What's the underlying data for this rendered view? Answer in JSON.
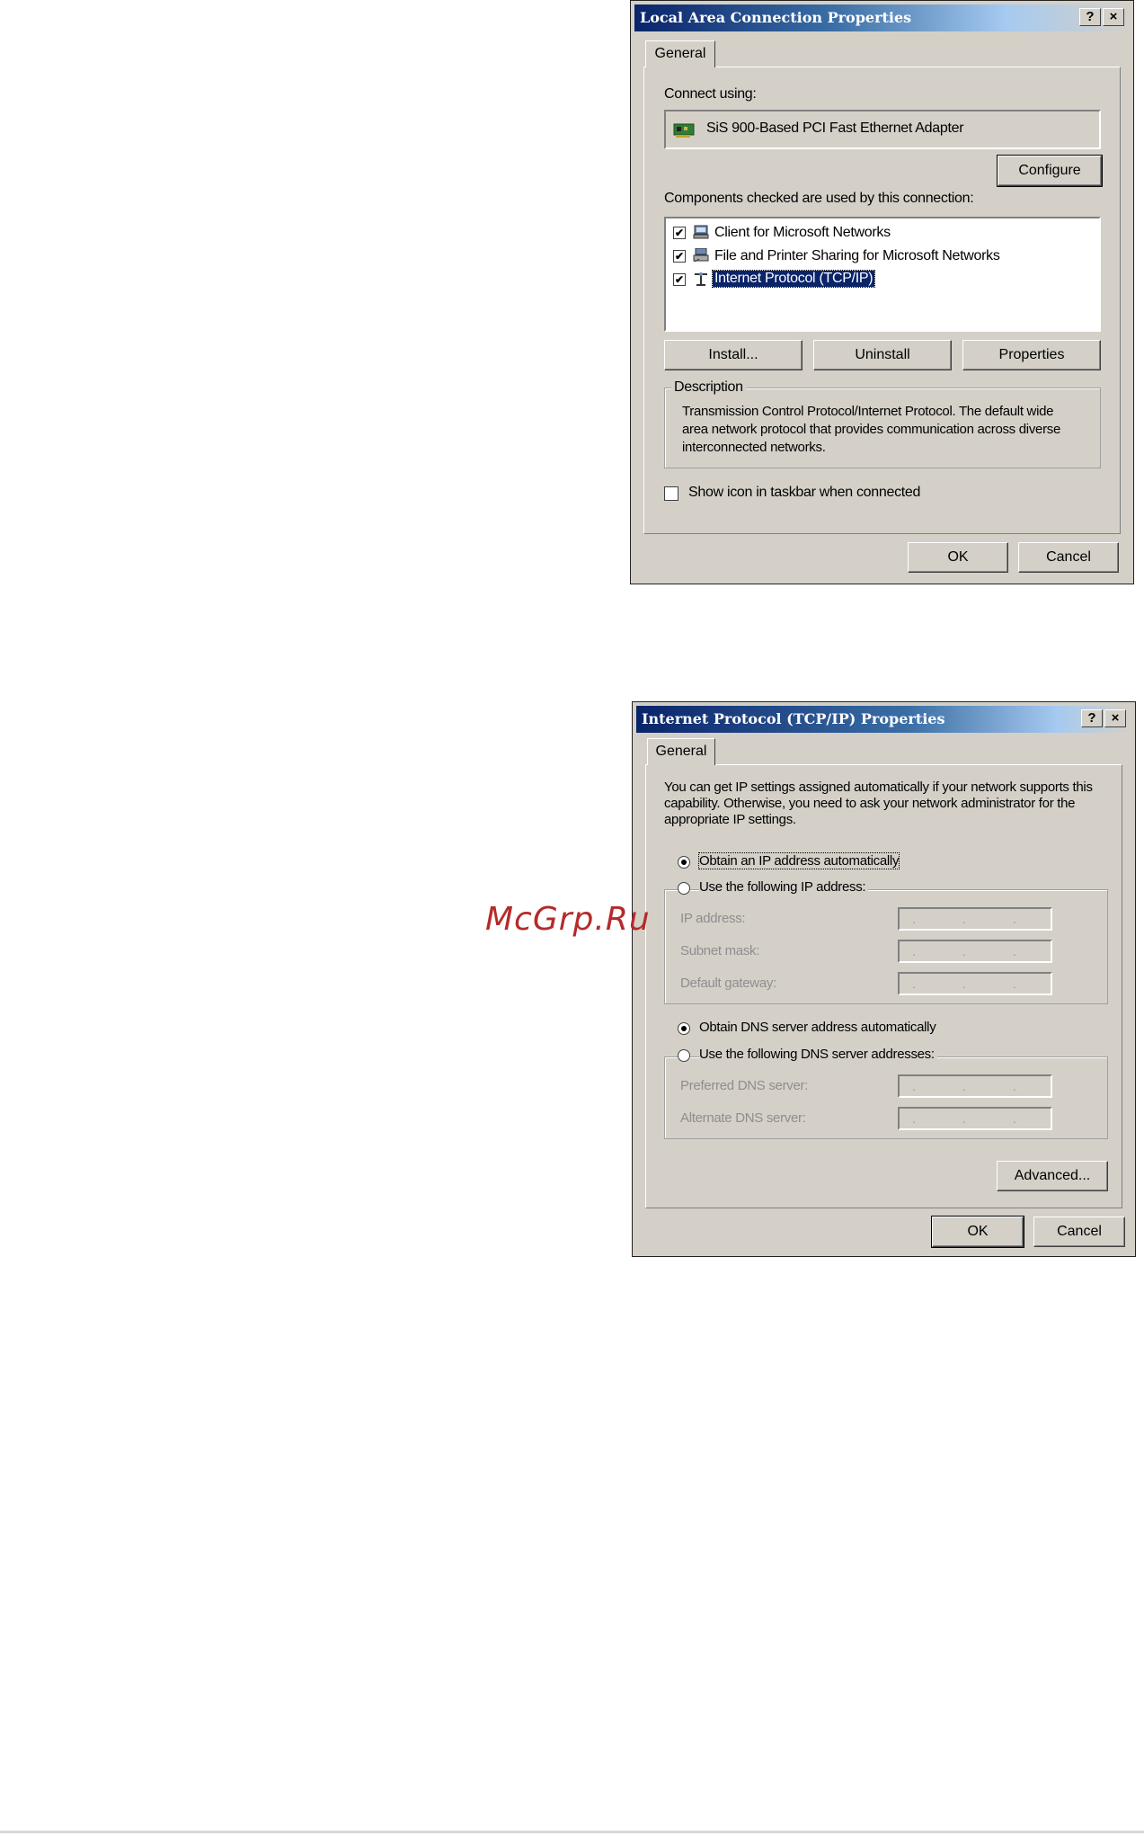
{
  "watermark": "McGrp.Ru",
  "dlg1": {
    "title": "Local Area Connection Properties",
    "help": "?",
    "close": "×",
    "tab": "General",
    "connect_using_label": "Connect using:",
    "adapter": "SiS 900-Based PCI Fast Ethernet Adapter",
    "configure": "Configure",
    "components_label": "Components checked are used by this connection:",
    "components": [
      {
        "label": "Client for Microsoft Networks",
        "checked": "✔",
        "icon": "network-client-icon"
      },
      {
        "label": "File and Printer Sharing for Microsoft Networks",
        "checked": "✔",
        "icon": "printer-sharing-icon"
      },
      {
        "label": "Internet Protocol (TCP/IP)",
        "checked": "✔",
        "icon": "protocol-icon"
      }
    ],
    "install": "Install...",
    "uninstall": "Uninstall",
    "properties": "Properties",
    "description_label": "Description",
    "description_text": "Transmission Control Protocol/Internet Protocol. The default wide area network protocol that provides communication across diverse interconnected networks.",
    "show_icon": "Show icon in taskbar when connected",
    "ok": "OK",
    "cancel": "Cancel"
  },
  "dlg2": {
    "title": "Internet Protocol (TCP/IP) Properties",
    "help": "?",
    "close": "×",
    "tab": "General",
    "intro": "You can get IP settings assigned automatically if your network supports this capability. Otherwise, you need to ask your network administrator for the appropriate IP settings.",
    "obtain_ip": "Obtain an IP address automatically",
    "use_ip": "Use the following IP address:",
    "ip_address": "IP address:",
    "subnet_mask": "Subnet mask:",
    "default_gateway": "Default gateway:",
    "obtain_dns": "Obtain DNS server address automatically",
    "use_dns": "Use the following DNS server addresses:",
    "preferred_dns": "Preferred DNS server:",
    "alternate_dns": "Alternate DNS server:",
    "advanced": "Advanced...",
    "ok": "OK",
    "cancel": "Cancel",
    "ip_placeholder": ". . ."
  },
  "colors": {
    "titlebar": "#0a246a",
    "dialog_bg": "#d4d0c8",
    "selection": "#0a246a"
  }
}
